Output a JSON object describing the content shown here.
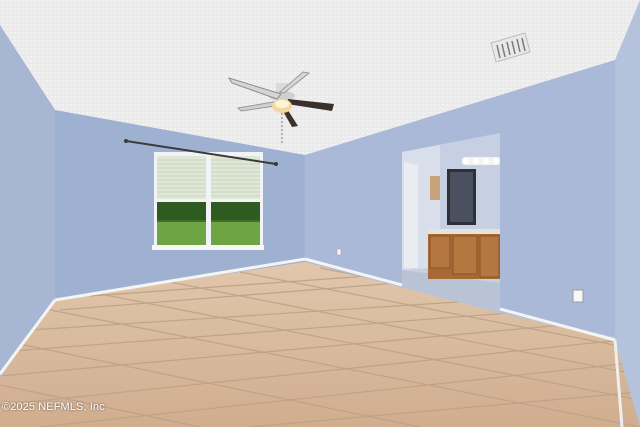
{
  "photo": {
    "watermark": "©2025 NEFMLS, Inc",
    "colors": {
      "wall": "#a9b9d6",
      "wall_shadow": "#94a6c8",
      "ceiling": "#f1f1f1",
      "floor_tile": "#d7b79a",
      "grout": "#b79f88",
      "baseboard": "#f5f5f5",
      "cabinet": "#a86a34",
      "grass": "#6da544",
      "tree": "#2f5a22"
    }
  }
}
